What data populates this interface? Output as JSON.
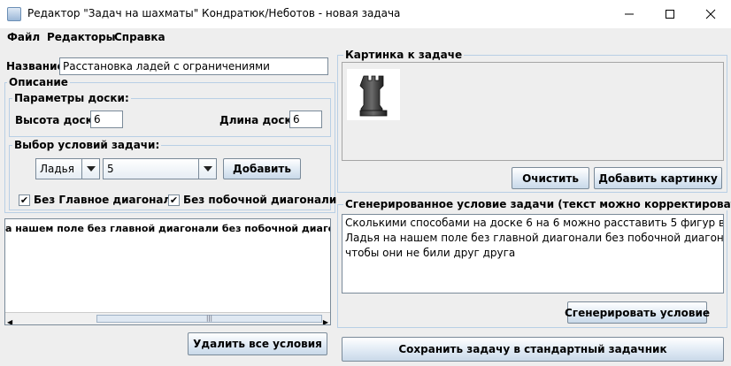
{
  "window": {
    "title": "Редактор \"Задач на шахматы\" Кондратюк/Неботов - новая задача"
  },
  "menu": [
    "Файл",
    "Редакторы",
    "Справка"
  ],
  "left": {
    "name_label": "Название",
    "name_value": "Расстановка ладей с ограничениями",
    "description_legend": "Описание",
    "board_legend": "Параметры доски:",
    "height_label": "Высота доски",
    "height_value": "6",
    "length_label": "Длина доски",
    "length_value": "6",
    "conditions_legend": "Выбор условий задачи:",
    "piece_value": "Ладья",
    "count_value": "5",
    "add_button": "Добавить",
    "checkbox_main_diag": "Без Главное диагонали",
    "checkbox_side_diag": "Без побочной диагонали",
    "conditions_text": "а нашем поле без главной диагонали без побочной диагонали",
    "delete_all_button": "Удалить все условия"
  },
  "right": {
    "picture_legend": "Картинка к задаче",
    "picture_icon": "chess-rook",
    "clear_button": "Очистить",
    "add_picture_button": "Добавить картинку",
    "generated_legend": "Сгенерированное условие задачи (текст можно корректировать)",
    "generated_lines": [
      "Сколькими способами на доске 6 на 6 можно расставить  5 фигур вида",
      "Ладья на нашем поле без главной диагонали без побочной диагонали , так",
      "чтобы они не били друг друга"
    ],
    "generate_button": "Сгенерировать условие",
    "save_button": "Сохранить задачу в стандартный задачник"
  },
  "colors": {
    "group_border": "#b8cfe5",
    "background": "#eeeeee"
  }
}
